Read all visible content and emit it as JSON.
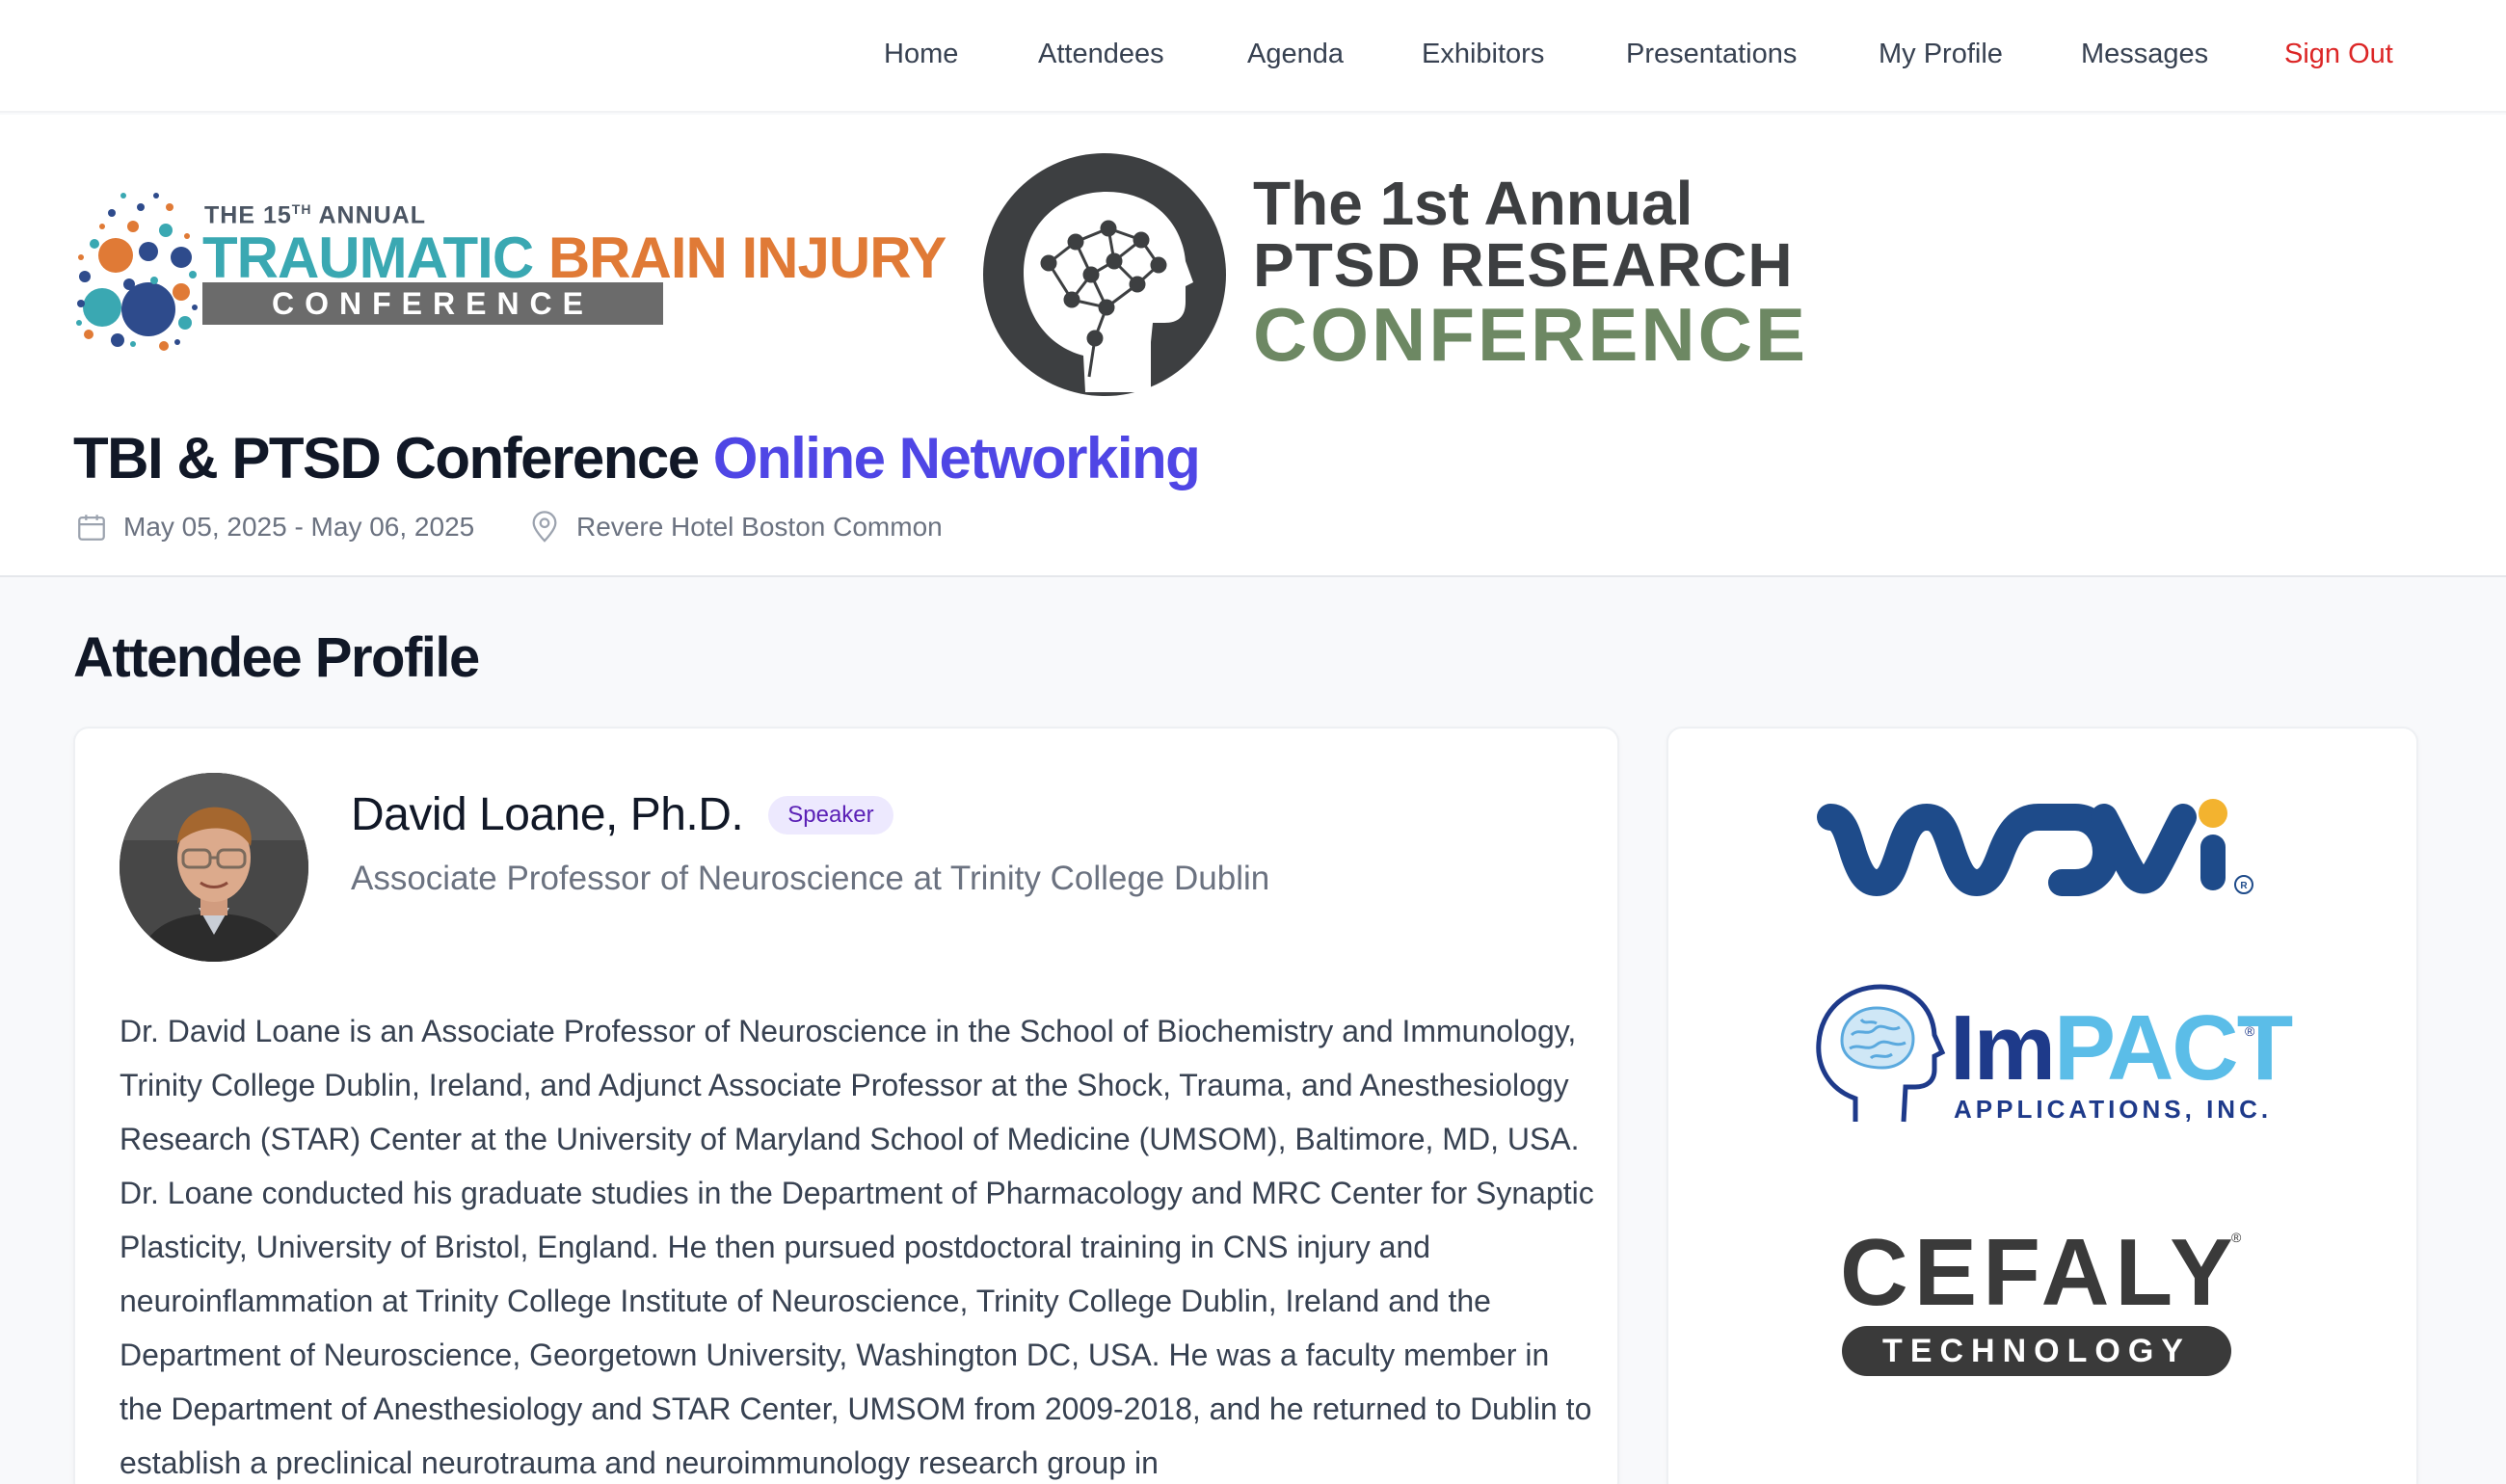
{
  "nav": {
    "items": [
      {
        "label": "Home"
      },
      {
        "label": "Attendees"
      },
      {
        "label": "Agenda"
      },
      {
        "label": "Exhibitors"
      },
      {
        "label": "Presentations"
      },
      {
        "label": "My Profile"
      },
      {
        "label": "Messages"
      },
      {
        "label": "Sign Out"
      }
    ]
  },
  "logos": {
    "tbi": {
      "small_prefix": "THE 15",
      "small_sup": "TH",
      "small_suffix": " ANNUAL",
      "line1_a": "TRAUMATIC ",
      "line1_b": "BRAIN INJURY",
      "line2": "CONFERENCE"
    },
    "ptsd": {
      "line1": "The 1st Annual",
      "line2": "PTSD RESEARCH",
      "line3": "CONFERENCE"
    }
  },
  "event": {
    "title_main": "TBI & PTSD Conference ",
    "title_accent": "Online Networking",
    "dates": "May 05, 2025 - May 06, 2025",
    "location": "Revere Hotel Boston Common"
  },
  "section_title": "Attendee Profile",
  "profile": {
    "name": "David Loane, Ph.D.",
    "badge": "Speaker",
    "title": "Associate Professor of Neuroscience at Trinity College Dublin",
    "bio": "Dr. David Loane is an Associate Professor of Neuroscience in the School of Biochemistry and Immunology, Trinity College Dublin, Ireland, and Adjunct Associate Professor at the Shock, Trauma, and Anesthesiology Research (STAR) Center at the University of Maryland School of Medicine (UMSOM), Baltimore, MD, USA. Dr. Loane conducted his graduate studies in the Department of Pharmacology and MRC Center for Synaptic Plasticity, University of Bristol, England. He then pursued postdoctoral training in CNS injury and neuroinflammation at Trinity College Institute of Neuroscience, Trinity College Dublin, Ireland and the Department of Neuroscience, Georgetown University, Washington DC, USA. He was a faculty member in the Department of Anesthesiology and STAR Center, UMSOM from 2009-2018, and he returned to Dublin to establish a preclinical neurotrauma and neuroimmunology research group in"
  },
  "sponsors": {
    "wavi": {
      "text": "wavi"
    },
    "impact": {
      "text_a": "Im",
      "text_b": "PACT",
      "sub": "APPLICATIONS, INC."
    },
    "cefaly": {
      "text": "CEFALY",
      "sub": "TECHNOLOGY"
    }
  },
  "colors": {
    "accent": "#4f46e5",
    "signout": "#dc2626",
    "badge_bg": "#ede9fe",
    "badge_text": "#5b21b6"
  }
}
